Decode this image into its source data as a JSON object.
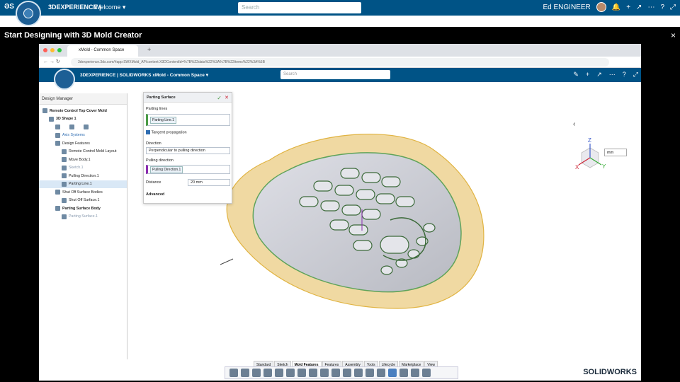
{
  "outer": {
    "brand": "3DEXPERIENCE |",
    "welcome": "Welcome ▾",
    "search_placeholder": "Search",
    "user": "Ed ENGINEER",
    "title": "Start Designing with 3D Mold Creator",
    "close": "×"
  },
  "browser": {
    "tab_title": "xMold - Common Space",
    "address": "3dexperience.3ds.com/#app:SWXMold_AP/content:X3DContentId=%7B%22data%22%3A%7B%22items%22%3A%5B"
  },
  "app": {
    "brand": "3DEXPERIENCE | SOLIDWORKS xMold - Common Space ▾",
    "search_placeholder": "Search"
  },
  "design_manager": {
    "title": "Design Manager",
    "items": [
      {
        "label": "Remote Control Top Cover Mold",
        "indent": 0,
        "style": "bold"
      },
      {
        "label": "3D Shape 1",
        "indent": 1,
        "style": "bold"
      },
      {
        "label": "",
        "indent": 2,
        "style": "icons"
      },
      {
        "label": "Axis Systems",
        "indent": 2,
        "style": "blue"
      },
      {
        "label": "Design Features",
        "indent": 2,
        "style": "normal"
      },
      {
        "label": "Remote Control Mold Layout",
        "indent": 3,
        "style": "normal"
      },
      {
        "label": "Move Body.1",
        "indent": 3,
        "style": "normal"
      },
      {
        "label": "Sketch.1",
        "indent": 3,
        "style": "gray"
      },
      {
        "label": "Pulling Direction.1",
        "indent": 3,
        "style": "normal"
      },
      {
        "label": "Parting Line.1",
        "indent": 3,
        "style": "selected"
      },
      {
        "label": "Shut Off Surface Bodies",
        "indent": 2,
        "style": "normal"
      },
      {
        "label": "Shut Off Surface.1",
        "indent": 3,
        "style": "normal"
      },
      {
        "label": "Parting Surface Body",
        "indent": 2,
        "style": "bold"
      },
      {
        "label": "Parting Surface.1",
        "indent": 3,
        "style": "gray"
      }
    ]
  },
  "dialog": {
    "title": "Parting Surface",
    "parting_lines_label": "Parting lines",
    "parting_line_chip": "Parting Line.1",
    "tangent_label": "Tangent propagation",
    "direction_label": "Direction",
    "direction_value": "Perpendicular to pulling direction",
    "pulling_label": "Pulling direction",
    "pulling_chip": "Pulling Direction.1",
    "distance_label": "Distance",
    "distance_value": "20 mm",
    "advanced_label": "Advanced"
  },
  "viewport": {
    "units": "mm"
  },
  "bottom_tabs": [
    "Standard",
    "Sketch",
    "Mold Features",
    "Features",
    "Assembly",
    "Tools",
    "Lifecycle",
    "Marketplace",
    "View"
  ],
  "logo": "SOLIDWORKS",
  "colors": {
    "topbar": "#005386",
    "accent_green": "#4a9b46",
    "parting_surface": "#f0d9a2"
  }
}
